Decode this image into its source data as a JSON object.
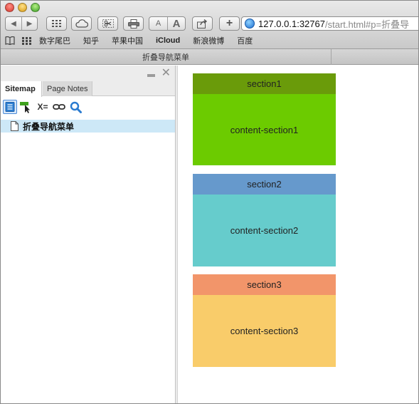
{
  "browser": {
    "url_host": "127.0.0.1:32767",
    "url_path": "/start.html#p=折叠导",
    "bookmarks": [
      "数字尾巴",
      "知乎",
      "苹果中国",
      "iCloud",
      "新浪微博",
      "百度"
    ],
    "tab_title": "折叠导航菜单",
    "font_small": "A",
    "font_large": "A"
  },
  "sidebar": {
    "tabs": [
      "Sitemap",
      "Page Notes"
    ],
    "tool_variable_label": "X=",
    "tree_items": [
      "折叠导航菜单"
    ]
  },
  "sections": [
    {
      "title": "section1",
      "content": "content-section1",
      "head_color": "#6a9b0a",
      "body_color": "#6ccb00"
    },
    {
      "title": "section2",
      "content": "content-section2",
      "head_color": "#6699cc",
      "body_color": "#66cccc"
    },
    {
      "title": "section3",
      "content": "content-section3",
      "head_color": "#f2956a",
      "body_color": "#f9cc6a"
    }
  ]
}
